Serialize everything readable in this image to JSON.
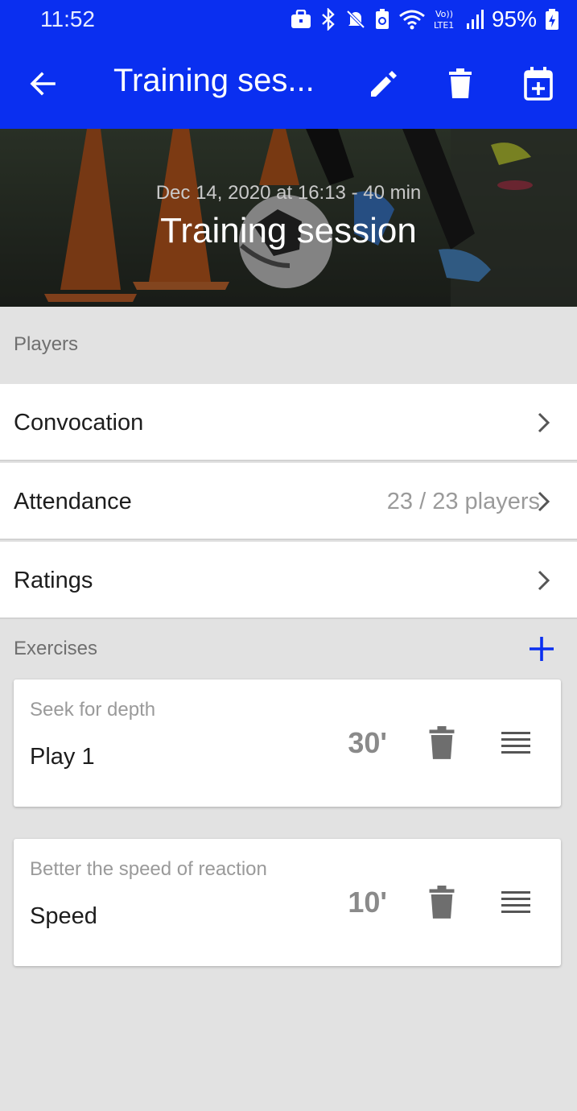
{
  "status_bar": {
    "time": "11:52",
    "battery": "95%",
    "icons": [
      "briefcase-icon",
      "bluetooth-icon",
      "mute-icon",
      "battery-saver-icon",
      "wifi-icon",
      "volte-icon",
      "signal-icon",
      "battery-charging-icon"
    ],
    "volte_label": "Vo)) LTE1"
  },
  "app_bar": {
    "title": "Training ses...",
    "background": "#0a2ff0",
    "icons": [
      "back-arrow-icon",
      "edit-pencil-icon",
      "trash-icon",
      "calendar-add-icon"
    ]
  },
  "hero": {
    "subtitle": "Dec 14, 2020 at 16:13 - 40 min",
    "title": "Training session"
  },
  "players_section": {
    "label": "Players",
    "rows": [
      {
        "label": "Convocation",
        "value": ""
      },
      {
        "label": "Attendance",
        "value": "23 / 23 players"
      },
      {
        "label": "Ratings",
        "value": ""
      }
    ]
  },
  "exercises_section": {
    "label": "Exercises",
    "add_icon": "plus-icon",
    "accent": "#0a2ff0",
    "cards": [
      {
        "subtitle": "Seek for depth",
        "name": "Play 1",
        "duration": "30'"
      },
      {
        "subtitle": "Better the speed of reaction",
        "name": "Speed",
        "duration": "10'"
      }
    ]
  }
}
